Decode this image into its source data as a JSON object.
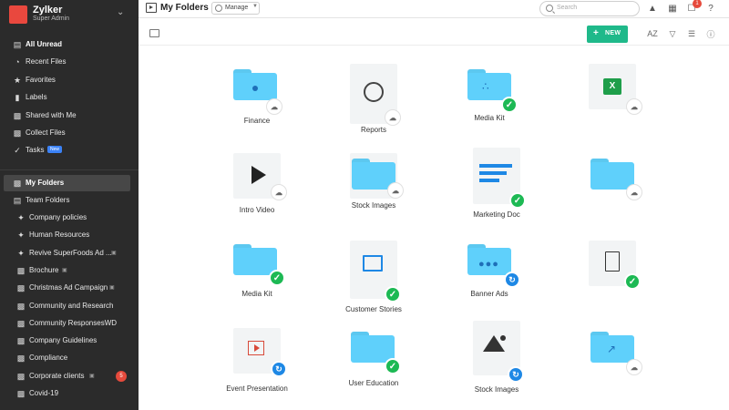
{
  "org": {
    "name": "Zylker",
    "role": "Super Admin"
  },
  "sidebar": {
    "top_items": [
      {
        "label": "All Unread",
        "icon": "inbox-icon"
      },
      {
        "label": "Recent Files",
        "icon": "clock-icon"
      },
      {
        "label": "Favorites",
        "icon": "star-icon"
      },
      {
        "label": "Labels",
        "icon": "label-icon"
      },
      {
        "label": "Shared with Me",
        "icon": "shared-icon"
      },
      {
        "label": "Collect Files",
        "icon": "collect-icon"
      },
      {
        "label": "Tasks",
        "icon": "check-icon",
        "badge": "New"
      }
    ],
    "my_folders": "My Folders",
    "team_folders": "Team Folders",
    "team_items": [
      {
        "label": "Company policies",
        "icon": "pin-icon"
      },
      {
        "label": "Human Resources",
        "icon": "pin-icon"
      },
      {
        "label": "Revive SuperFoods Ad ...",
        "icon": "pin-icon",
        "locked": true
      },
      {
        "label": "Brochure",
        "icon": "team-folder-icon",
        "locked": true
      },
      {
        "label": "Christmas Ad Campaign",
        "icon": "team-folder-icon",
        "locked": true
      },
      {
        "label": "Community and Research",
        "icon": "team-folder-icon"
      },
      {
        "label": "Community ResponsesWD",
        "icon": "team-folder-icon"
      },
      {
        "label": "Company Guidelines",
        "icon": "team-folder-icon"
      },
      {
        "label": "Compliance",
        "icon": "team-folder-icon"
      },
      {
        "label": "Corporate clients",
        "icon": "team-folder-icon",
        "locked": true,
        "count": "5"
      },
      {
        "label": "Covid-19",
        "icon": "team-folder-icon"
      }
    ]
  },
  "header": {
    "title": "My Folders",
    "manage_label": "Manage",
    "search_placeholder": "Search",
    "notification_count": "1"
  },
  "toolbar": {
    "new_label": "NEW",
    "sort_label": "AZ"
  },
  "items": [
    {
      "name": "Finance",
      "kind": "folder",
      "status": "cloud"
    },
    {
      "name": "Reports",
      "kind": "report-file",
      "status": "cloud"
    },
    {
      "name": "Media Kit",
      "kind": "media-folder",
      "status": "check"
    },
    {
      "name": "",
      "kind": "spreadsheet-file",
      "status": "cloud"
    },
    {
      "name": "Intro Video",
      "kind": "video-file",
      "status": "cloud"
    },
    {
      "name": "Stock Images",
      "kind": "folder-in-tile",
      "status": "cloud"
    },
    {
      "name": "Marketing Doc",
      "kind": "document-file",
      "status": "check"
    },
    {
      "name": "",
      "kind": "folder",
      "status": "cloud"
    },
    {
      "name": "Media Kit",
      "kind": "folder",
      "status": "check"
    },
    {
      "name": "Customer Stories",
      "kind": "presentation-file",
      "status": "check"
    },
    {
      "name": "Banner Ads",
      "kind": "group-folder",
      "status": "sync"
    },
    {
      "name": "",
      "kind": "pdf-file",
      "status": "check"
    },
    {
      "name": "Event Presentation",
      "kind": "slides-file",
      "status": "sync"
    },
    {
      "name": "User Education",
      "kind": "folder-in-tile",
      "status": "check"
    },
    {
      "name": "Stock Images",
      "kind": "image-file",
      "status": "sync"
    },
    {
      "name": "",
      "kind": "chart-folder",
      "status": "cloud"
    }
  ],
  "colors": {
    "sidebar_bg": "#2b2b2b",
    "accent_green": "#1fb98a",
    "folder_blue": "#5fd0fb",
    "check_green": "#1db954",
    "sync_blue": "#1e88e5"
  }
}
